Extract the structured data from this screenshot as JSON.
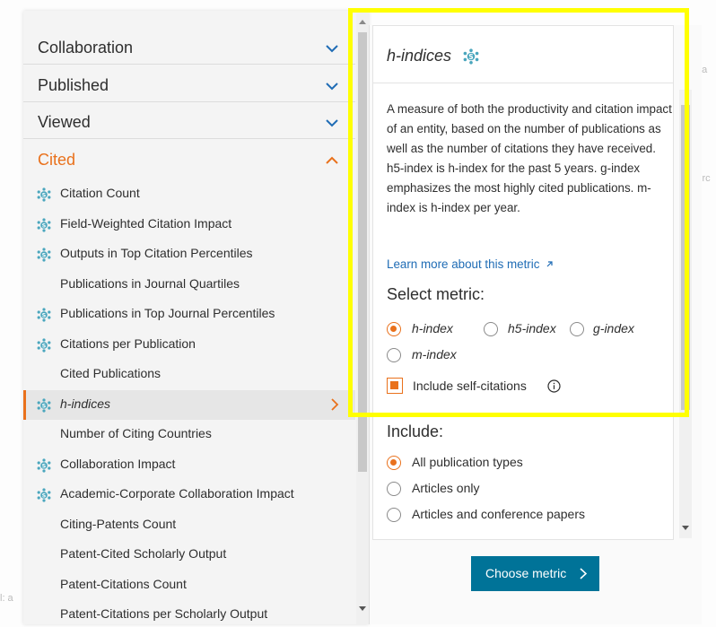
{
  "left_panel": {
    "categories": [
      {
        "label": "Collaboration",
        "expanded": false
      },
      {
        "label": "Published",
        "expanded": false
      },
      {
        "label": "Viewed",
        "expanded": false
      },
      {
        "label": "Cited",
        "expanded": true
      }
    ],
    "cited_items": [
      {
        "label": "Citation Count",
        "icon": "snowball-icon"
      },
      {
        "label": "Field-Weighted Citation Impact",
        "icon": "snowball-icon"
      },
      {
        "label": "Outputs in Top Citation Percentiles",
        "icon": "snowball-icon"
      },
      {
        "label": "Publications in Journal Quartiles",
        "icon": null
      },
      {
        "label": "Publications in Top Journal Percentiles",
        "icon": "snowball-icon"
      },
      {
        "label": "Citations per Publication",
        "icon": "snowball-icon"
      },
      {
        "label": "Cited Publications",
        "icon": null
      },
      {
        "label": "h-indices",
        "icon": "snowball-icon",
        "selected": true
      },
      {
        "label": "Number of Citing Countries",
        "icon": null
      },
      {
        "label": "Collaboration Impact",
        "icon": "snowball-icon"
      },
      {
        "label": "Academic-Corporate Collaboration Impact",
        "icon": "snowball-icon"
      },
      {
        "label": "Citing-Patents Count",
        "icon": null
      },
      {
        "label": "Patent-Cited Scholarly Output",
        "icon": null
      },
      {
        "label": "Patent-Citations Count",
        "icon": null
      },
      {
        "label": "Patent-Citations per Scholarly Output",
        "icon": null
      }
    ]
  },
  "detail": {
    "title": "h-indices",
    "description": "A measure of both the productivity and citation impact of an entity, based on the number of publications as well as the number of citations they have received. h5-index is h-index for the past 5 years. g-index emphasizes the most highly cited publications. m-index is h-index per year.",
    "learn_more": "Learn more about this metric",
    "select_metric_label": "Select metric:",
    "metric_options": [
      {
        "label": "h-index",
        "selected": true
      },
      {
        "label": "h5-index",
        "selected": false
      },
      {
        "label": "g-index",
        "selected": false
      },
      {
        "label": "m-index",
        "selected": false
      }
    ],
    "self_citations_label": "Include self-citations",
    "self_citations_checked": true,
    "include_label": "Include:",
    "include_options": [
      {
        "label": "All publication types",
        "selected": true
      },
      {
        "label": "Articles only",
        "selected": false
      },
      {
        "label": "Articles and conference papers",
        "selected": false
      }
    ],
    "choose_button": "Choose metric"
  },
  "background": {
    "partial_right_1": "na",
    "partial_right_2": "irc",
    "partial_left": "l: a"
  },
  "colors": {
    "accent_orange": "#e9711c",
    "chevron_blue": "#1f6cb5",
    "button_teal": "#007398",
    "highlight_yellow": "#ffff00",
    "icon_teal": "#4aa6bd"
  }
}
